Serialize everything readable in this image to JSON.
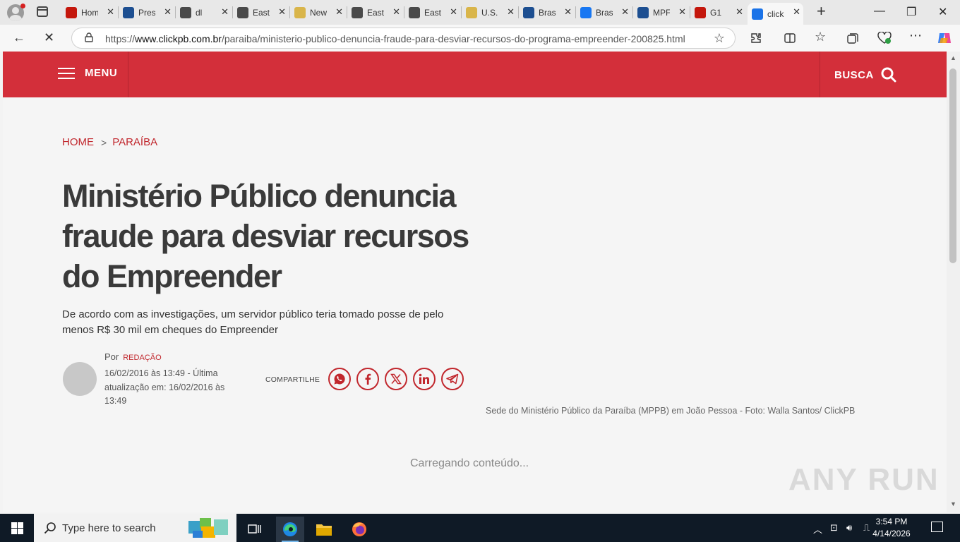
{
  "browser": {
    "tabs": [
      {
        "label": "Hom",
        "favicon": "g1-icon",
        "color": "#c4170c"
      },
      {
        "label": "Pres",
        "favicon": "news-icon",
        "color": "#1d4f91"
      },
      {
        "label": "dl",
        "favicon": "seal-icon",
        "color": "#4a4a4a"
      },
      {
        "label": "East",
        "favicon": "seal-icon",
        "color": "#4a4a4a"
      },
      {
        "label": "New",
        "favicon": "star-icon",
        "color": "#d9b54a"
      },
      {
        "label": "East",
        "favicon": "seal-icon",
        "color": "#4a4a4a"
      },
      {
        "label": "East",
        "favicon": "seal-icon",
        "color": "#4a4a4a"
      },
      {
        "label": "U.S.",
        "favicon": "eagle-icon",
        "color": "#d9b54a"
      },
      {
        "label": "Bras",
        "favicon": "gn-icon",
        "color": "#1d4f91"
      },
      {
        "label": "Bras",
        "favicon": "f-icon",
        "color": "#1877f2"
      },
      {
        "label": "MPF",
        "favicon": "news-icon",
        "color": "#1d4f91"
      },
      {
        "label": "G1",
        "favicon": "g1-icon",
        "color": "#c4170c"
      },
      {
        "label": "click",
        "favicon": "loading-icon",
        "color": "#1a73e8"
      }
    ],
    "url_prefix": "https://",
    "url_domain": "www.clickpb.com.br",
    "url_path": "/paraiba/ministerio-publico-denuncia-fraude-para-desviar-recursos-do-programa-empreender-200825.html"
  },
  "site": {
    "menu_label": "MENU",
    "search_label": "BUSCA",
    "brand_color": "#d32f3a"
  },
  "article": {
    "breadcrumb": [
      "HOME",
      "PARAÍBA"
    ],
    "title": "Ministério Público denuncia fraude para desviar recursos do Empreender",
    "subtitle": "De acordo com as investigações, um servidor público teria tomado posse de pelo menos R$ 30 mil em cheques do Empreender",
    "by_prefix": "Por",
    "author": "REDAÇÃO",
    "dates": "16/02/2016 às 13:49 - Última atualização em: 16/02/2016 às 13:49",
    "share_label": "COMPARTILHE",
    "share_icons": [
      "whatsapp-icon",
      "facebook-icon",
      "x-icon",
      "linkedin-icon",
      "telegram-icon"
    ],
    "photo_caption": "Sede do Ministério Público da Paraíba (MPPB) em João Pessoa - Foto: Walla Santos/ ClickPB",
    "loading_text": "Carregando conteúdo..."
  },
  "watermark": "ANY RUN",
  "taskbar": {
    "search_placeholder": "Type here to search",
    "time": "3:54 PM",
    "date": "4/14/2026"
  }
}
